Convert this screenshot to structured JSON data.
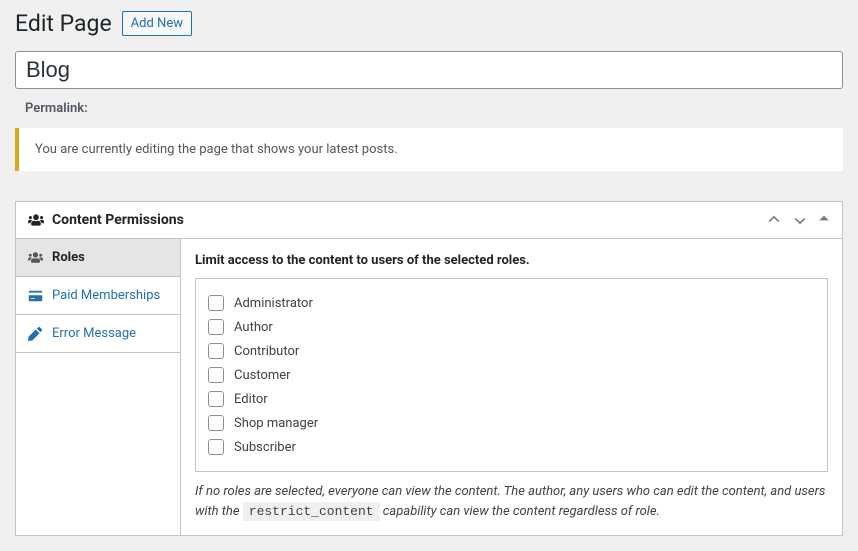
{
  "heading": {
    "title": "Edit Page",
    "add_new": "Add New"
  },
  "title_field": {
    "value": "Blog"
  },
  "permalink_label": "Permalink:",
  "notice": "You are currently editing the page that shows your latest posts.",
  "postbox": {
    "title": "Content Permissions",
    "tabs": [
      {
        "label": "Roles",
        "active": true,
        "icon": "users-icon"
      },
      {
        "label": "Paid Memberships",
        "active": false,
        "icon": "card-icon"
      },
      {
        "label": "Error Message",
        "active": false,
        "icon": "pencil-icon"
      }
    ],
    "roles_panel": {
      "heading": "Limit access to the content to users of the selected roles.",
      "roles": [
        "Administrator",
        "Author",
        "Contributor",
        "Customer",
        "Editor",
        "Shop manager",
        "Subscriber"
      ],
      "help_prefix": "If no roles are selected, everyone can view the content. The author, any users who can edit the content, and users with the ",
      "help_code": "restrict_content",
      "help_suffix": " capability can view the content regardless of role."
    }
  }
}
